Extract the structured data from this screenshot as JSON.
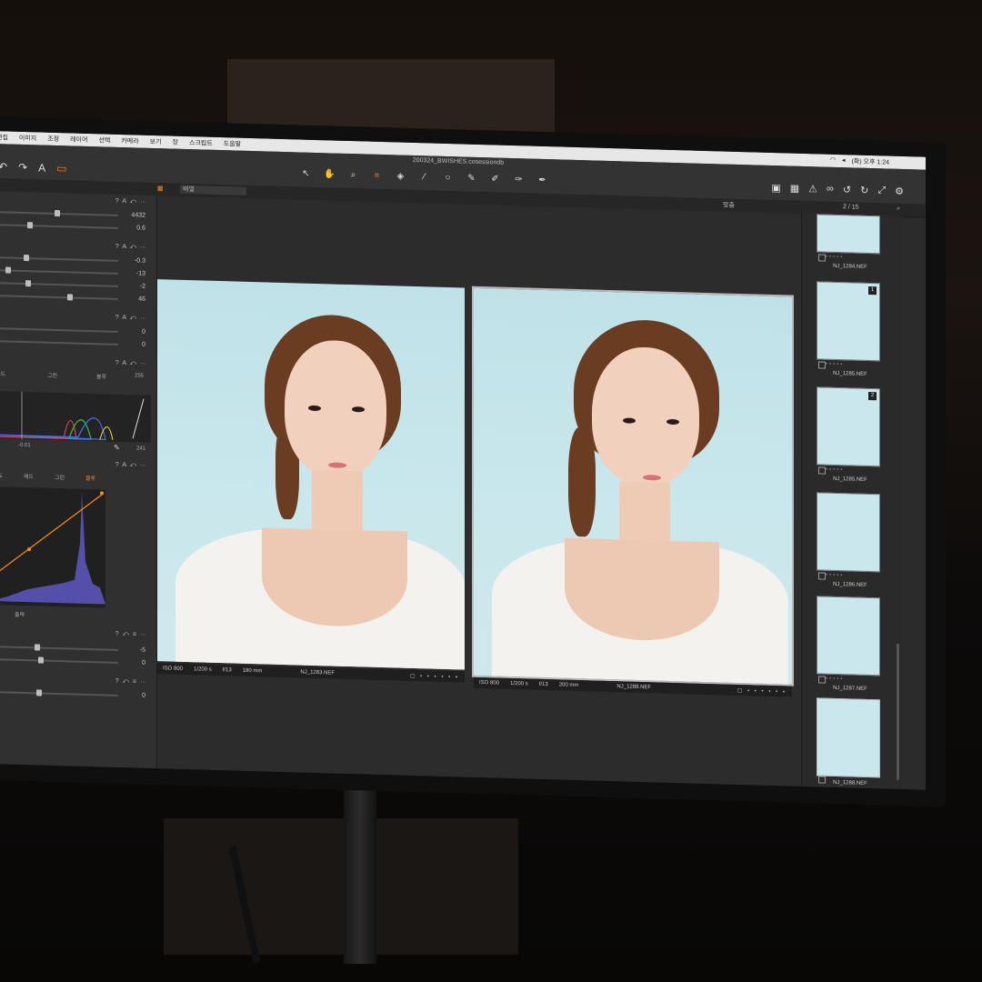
{
  "menubar": {
    "items": [
      "편집",
      "이미지",
      "조정",
      "레이어",
      "선택",
      "카메라",
      "보기",
      "창",
      "스크립트",
      "도움말"
    ],
    "clock": "(화) 오후 1:24"
  },
  "toolbar": {
    "document_title": "200324_BWISHES.cosessiondb",
    "cursor_tools": [
      "cursor-tool",
      "pan-tool",
      "zoom-tool",
      "crop-tool",
      "keystone-tool",
      "straighten-tool",
      "spot-tool",
      "brush-tool",
      "eraser-tool",
      "gradient-tool",
      "picker-tool"
    ]
  },
  "subbar": {
    "view_select": "배열",
    "zoom_label": "맞춤",
    "counter": "2 / 15"
  },
  "leftpanel": {
    "wb_values": [
      "4432",
      "0.6"
    ],
    "exposure_values": [
      "-0.3",
      "-13",
      "-2",
      "46"
    ],
    "hdr_values": [
      "0",
      "0"
    ],
    "levels_labels": [
      "레드",
      "그린",
      "블루"
    ],
    "levels_top_value": "255",
    "levels_low_value": "-0.01",
    "levels_high_value": "241",
    "curve_labels": [
      "휘도",
      "레드",
      "그린",
      "블루"
    ],
    "curve_bottom_label": "출력",
    "clarity_values": [
      "-5",
      "0"
    ],
    "sharp_values": [
      "0"
    ]
  },
  "viewer": {
    "left_meta": {
      "iso": "ISO 800",
      "shutter": "1/200 s",
      "aperture": "f/13",
      "focal": "180 mm",
      "file": "NJ_1283.NEF"
    },
    "right_meta": {
      "iso": "ISO 800",
      "shutter": "1/200 s",
      "aperture": "f/13",
      "focal": "200 mm",
      "file": "NJ_1288.NEF"
    }
  },
  "browser": {
    "thumbs": [
      {
        "file": "NJ_1284.NEF",
        "badge": ""
      },
      {
        "file": "NJ_1285.NEF",
        "badge": "1"
      },
      {
        "file": "NJ_1285.NEF",
        "badge": "2"
      },
      {
        "file": "NJ_1286.NEF",
        "badge": ""
      },
      {
        "file": "NJ_1287.NEF",
        "badge": ""
      },
      {
        "file": "NJ_1288.NEF",
        "badge": ""
      }
    ]
  },
  "colors": {
    "accent": "#ff8a1d",
    "panel": "#303031",
    "backdrop": "#c9e7ec",
    "red": "#e04848",
    "green": "#3fbf4a",
    "blue": "#4a6ff0",
    "luma": "#5a55b8"
  }
}
